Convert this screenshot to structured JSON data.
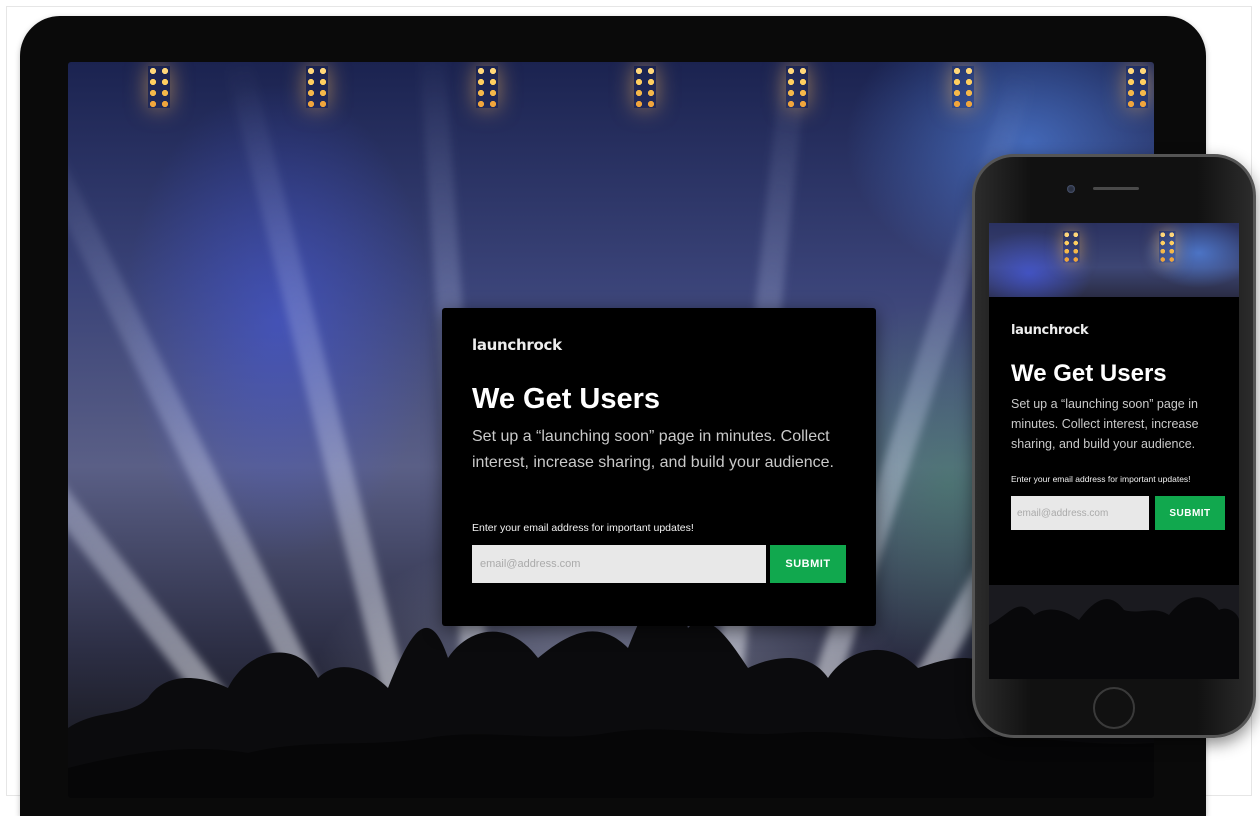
{
  "brand": {
    "logo_text": "launchrock"
  },
  "hero": {
    "headline": "We Get Users",
    "description": "Set up a “launching soon” page in minutes. Collect interest, increase sharing, and build your audience.",
    "email_prompt": "Enter your email address for important updates!",
    "email_placeholder": "email@address.com",
    "submit_label": "SUBMIT"
  },
  "colors": {
    "submit_green": "#11a84e",
    "card_background": "#000000",
    "device_frame": "#0a0a0a"
  },
  "icons": {
    "phone_camera": "camera-icon",
    "phone_home": "home-button-icon"
  }
}
